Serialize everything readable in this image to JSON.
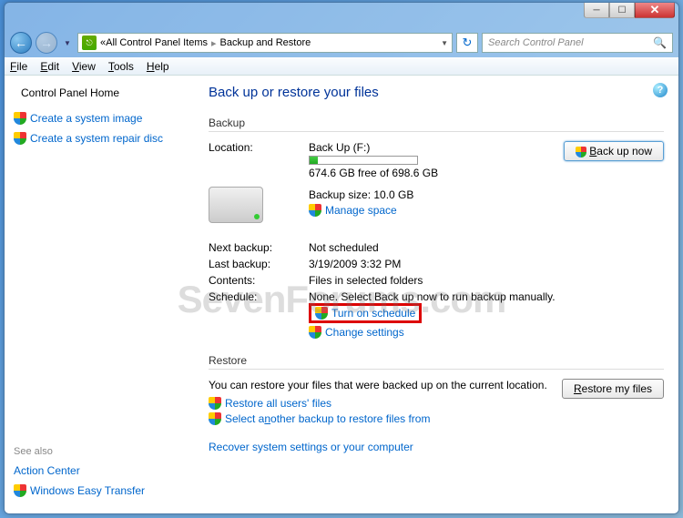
{
  "titlebar": {},
  "address": {
    "allitems": "All Control Panel Items",
    "current": "Backup and Restore"
  },
  "search": {
    "placeholder": "Search Control Panel"
  },
  "menu": {
    "file": "File",
    "edit": "Edit",
    "view": "View",
    "tools": "Tools",
    "help": "Help"
  },
  "sidebar": {
    "home": "Control Panel Home",
    "link1": "Create a system image",
    "link2": "Create a system repair disc",
    "seealso": "See also",
    "sa1": "Action Center",
    "sa2": "Windows Easy Transfer"
  },
  "main": {
    "title": "Back up or restore your files",
    "backup_hdr": "Backup",
    "btn_backup": "Back up now",
    "loc_label": "Location:",
    "loc_val": "Back Up (F:)",
    "free": "674.6 GB free of 698.6 GB",
    "size": "Backup size: 10.0 GB",
    "manage": "Manage space",
    "next_label": "Next backup:",
    "next_val": "Not scheduled",
    "last_label": "Last backup:",
    "last_val": "3/19/2009 3:32 PM",
    "content_label": "Contents:",
    "content_val": "Files in selected folders",
    "sched_label": "Schedule:",
    "sched_val": "None. Select Back up now to run backup manually.",
    "turnon": "Turn on schedule",
    "change": "Change settings",
    "restore_hdr": "Restore",
    "restore_txt": "You can restore your files that were backed up on the current location.",
    "btn_restore": "Restore my files",
    "rlink1": "Restore all users' files",
    "rlink2": "Select another backup to restore files from",
    "recover": "Recover system settings or your computer"
  },
  "watermark": "SevenForums.com"
}
